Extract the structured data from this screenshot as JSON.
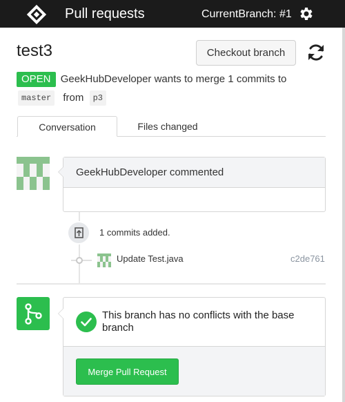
{
  "header": {
    "title": "Pull requests",
    "current_branch": "CurrentBranch: #1",
    "logo_icon": "app-logo-icon",
    "settings_icon": "gear-icon",
    "background": "#1b1b1b"
  },
  "pull_request": {
    "title": "test3",
    "checkout_label": "Checkout branch",
    "refresh_icon": "refresh-icon",
    "status": "OPEN",
    "status_color": "#2cbe4e",
    "summary": "GeekHubDeveloper wants to merge 1 commits to",
    "base_branch": "master",
    "from_word": "from",
    "head_branch": "p3"
  },
  "tabs": [
    {
      "label": "Conversation",
      "active": true
    },
    {
      "label": "Files changed",
      "active": false
    }
  ],
  "timeline": {
    "comment_header": "GeekHubDeveloper commented",
    "commits_added": "1 commits added.",
    "commit": {
      "message": "Update Test.java",
      "sha": "c2de761"
    }
  },
  "merge": {
    "message": "This branch has no conflicts with the base branch",
    "button_label": "Merge Pull Request",
    "accent": "#2cbe4e"
  }
}
